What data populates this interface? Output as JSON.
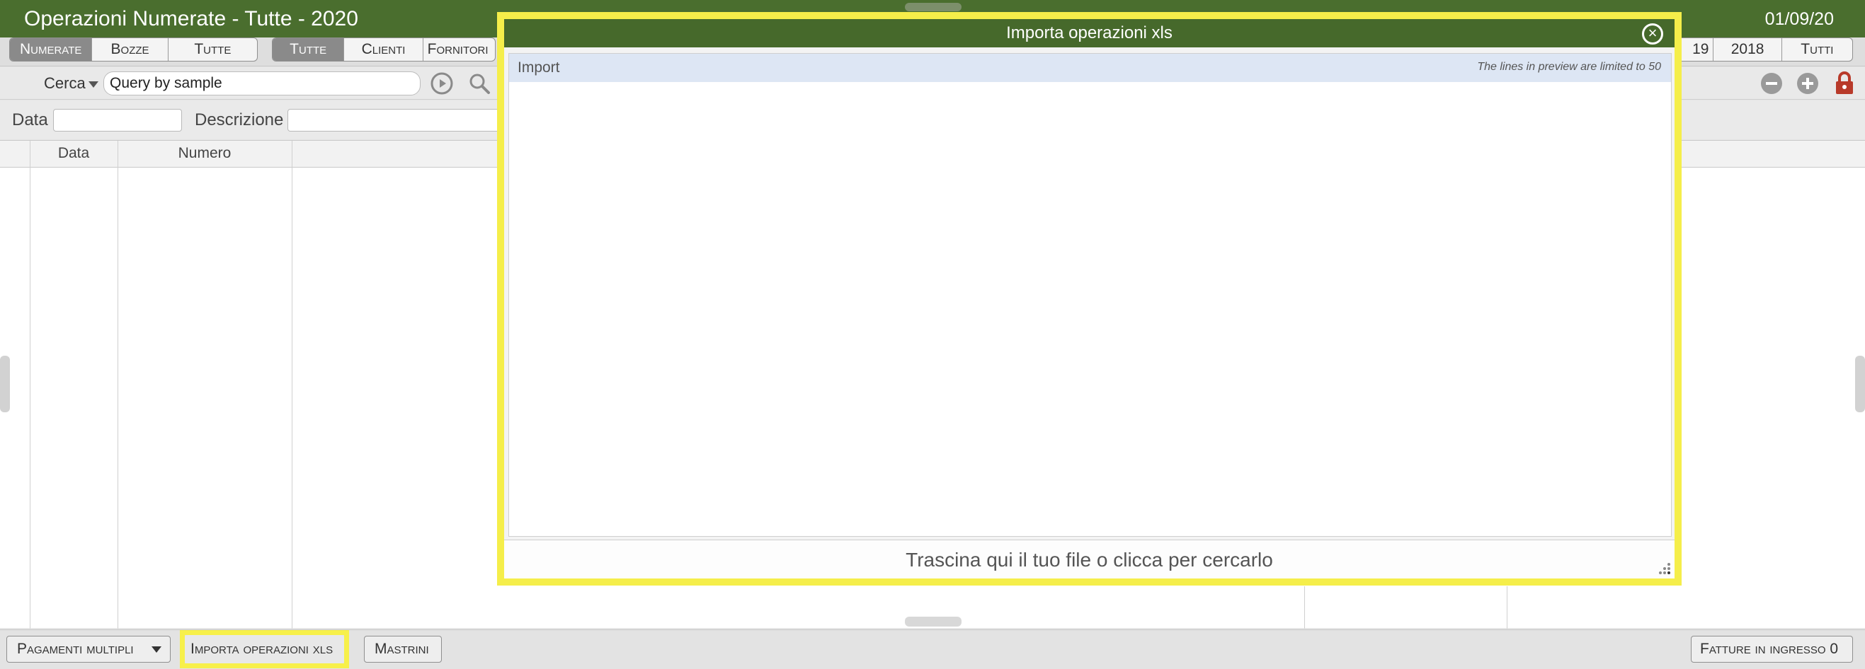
{
  "window": {
    "title": "Operazioni Numerate - Tutte - 2020",
    "date": "01/09/20"
  },
  "toolbar": {
    "group1": [
      "Numerate",
      "Bozze",
      "Tutte"
    ],
    "group2": [
      "Tutte",
      "Clienti",
      "Fornitori"
    ],
    "years": [
      "19",
      "2018",
      "Tutti"
    ]
  },
  "search": {
    "label": "Cerca",
    "value": "Query by sample"
  },
  "filters": {
    "data_label": "Data",
    "descrizione_label": "Descrizione"
  },
  "grid": {
    "columns": [
      "Data",
      "Numero"
    ]
  },
  "footer": {
    "pagamenti": "Pagamenti multipli",
    "importa": "Importa operazioni xls",
    "mastrini": "Mastrini",
    "fatture": "Fatture in ingresso 0"
  },
  "dialog": {
    "title": "Importa operazioni xls",
    "preview_label": "Import",
    "preview_note": "The lines in preview are limited to 50",
    "dropzone": "Trascina qui il tuo file o clicca per cercarlo"
  },
  "colors": {
    "header_green": "#4a6e2e",
    "highlight": "#f5ee4a",
    "lock_red": "#b83a2a"
  },
  "icons": [
    "play-icon",
    "search-icon",
    "remove-icon",
    "add-icon",
    "lock-icon",
    "close-icon",
    "dropdown-icon",
    "resize-grip-icon"
  ]
}
